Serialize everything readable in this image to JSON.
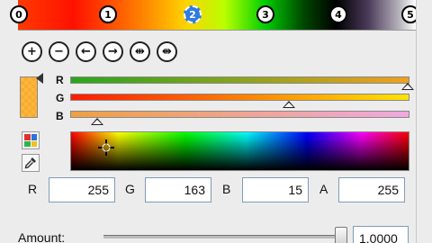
{
  "gradient_strip": {
    "stops": [
      {
        "label": "0"
      },
      {
        "label": "1"
      },
      {
        "label": "2",
        "selected": true
      },
      {
        "label": "3"
      },
      {
        "label": "4"
      },
      {
        "label": "5"
      }
    ]
  },
  "toolbar": {
    "buttons": [
      {
        "icon": "plus-icon",
        "glyph": "+"
      },
      {
        "icon": "minus-icon",
        "glyph": "−"
      },
      {
        "icon": "arrow-left-icon",
        "glyph": "←"
      },
      {
        "icon": "arrow-right-icon",
        "glyph": "→"
      },
      {
        "icon": "spread-in-icon",
        "glyph": "⇹"
      },
      {
        "icon": "spread-out-icon",
        "glyph": "⇼"
      }
    ]
  },
  "channels": {
    "r_label": "R",
    "g_label": "G",
    "b_label": "B",
    "colors": {
      "r_bar_from": "#27a61b",
      "r_bar_to": "#f0a020",
      "g_bar_from": "#ff1a00",
      "g_bar_to": "#ffe400",
      "b_bar_from": "#f0a040",
      "b_bar_to": "#f0a8e0"
    },
    "r_level": 1.0,
    "g_level": 0.64,
    "b_level": 0.06
  },
  "fields": {
    "r_label": "R",
    "r_value": "255",
    "g_label": "G",
    "g_value": "163",
    "b_label": "B",
    "b_value": "15",
    "a_label": "A",
    "a_value": "255"
  },
  "amount": {
    "label": "Amount:",
    "value": "1.0000",
    "level": 1.0
  }
}
